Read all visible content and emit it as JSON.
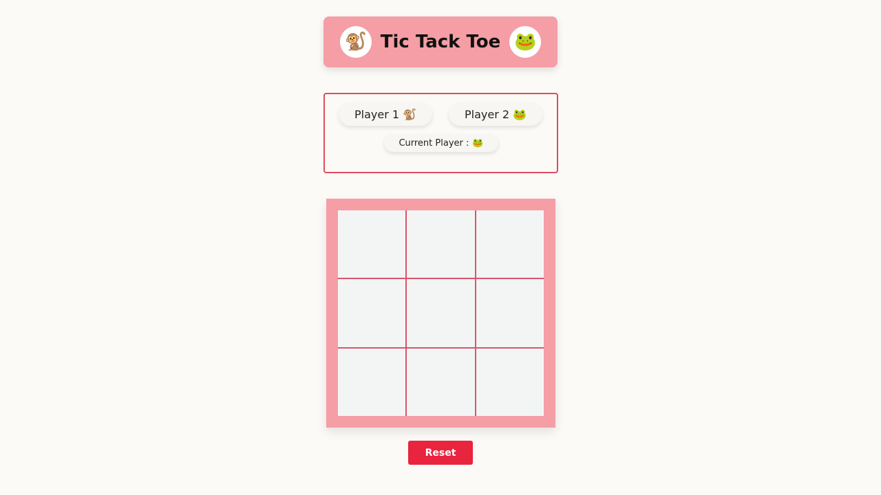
{
  "header": {
    "title": "Tic Tack Toe",
    "left_avatar": "🐒",
    "right_avatar": "🐸"
  },
  "players": {
    "player1": {
      "label": "Player 1",
      "emoji": "🐒"
    },
    "player2": {
      "label": "Player 2",
      "emoji": "🐸"
    },
    "current": {
      "label": "Current Player :",
      "emoji": "🐸"
    }
  },
  "board": {
    "cells": [
      "",
      "",
      "",
      "",
      "",
      "",
      "",
      "",
      ""
    ]
  },
  "controls": {
    "reset_label": "Reset"
  },
  "colors": {
    "background": "#fcfaf7",
    "header_bg": "#f59ea5",
    "board_frame": "#f59ea5",
    "grid_lines": "#d9546a",
    "cell_bg": "#f3f5f5",
    "info_border": "#e04a5d",
    "reset_bg": "#e8243f"
  }
}
